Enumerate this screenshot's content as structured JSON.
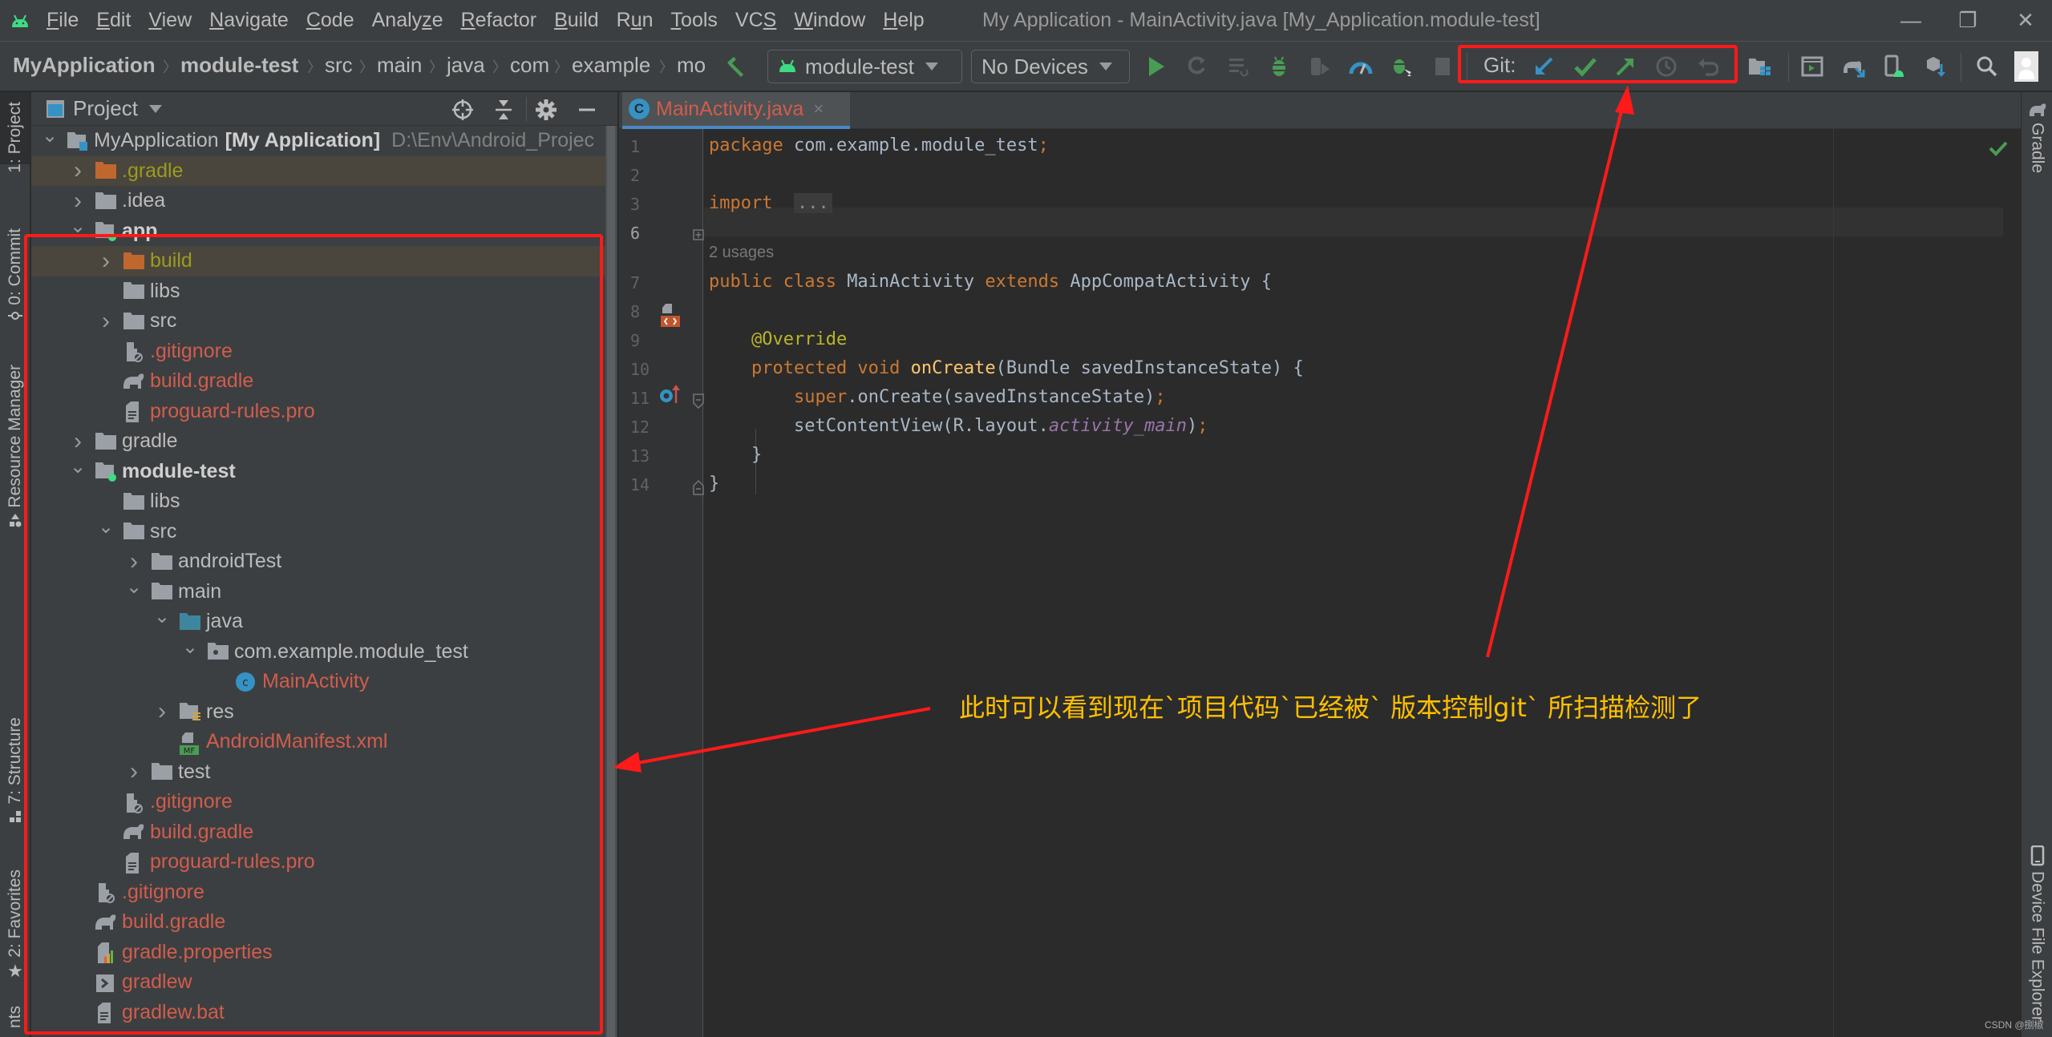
{
  "menubar": {
    "items": [
      "File",
      "Edit",
      "View",
      "Navigate",
      "Code",
      "Analyze",
      "Refactor",
      "Build",
      "Run",
      "Tools",
      "VCS",
      "Window",
      "Help"
    ],
    "mnemonics": [
      "F",
      "E",
      "V",
      "N",
      "C",
      "z",
      "R",
      "B",
      "u",
      "T",
      "S",
      "W",
      "H"
    ],
    "window_title": "My Application - MainActivity.java [My_Application.module-test]",
    "controls": {
      "minimize": "—",
      "restore": "❐",
      "close": "✕"
    }
  },
  "toolbar": {
    "breadcrumbs": [
      "MyApplication",
      "module-test",
      "src",
      "main",
      "java",
      "com",
      "example",
      "mo"
    ],
    "run_config": "module-test",
    "device": "No Devices",
    "git_label": "Git:",
    "git_actions": [
      "update-project",
      "commit",
      "push",
      "show-history",
      "rollback"
    ],
    "icons": [
      "make-project",
      "run",
      "apply-changes",
      "apply-code-changes",
      "debug",
      "profile",
      "attach-debugger",
      "stop",
      "project-structure",
      "avd-manager",
      "sync-gradle",
      "sdk-manager",
      "device-manager",
      "search",
      "account"
    ]
  },
  "left_strip": {
    "tabs": [
      "1: Project",
      "0: Commit",
      "Resource Manager",
      "7: Structure",
      "2: Favorites",
      "nts"
    ]
  },
  "project_panel": {
    "title": "Project",
    "tree": [
      {
        "label": "MyApplication",
        "extra": "[My Application]",
        "path": "D:\\Env\\Android_Projec",
        "depth": 0,
        "expand": "open",
        "icon": "module",
        "style": "normal"
      },
      {
        "label": ".gradle",
        "depth": 1,
        "expand": "closed",
        "icon": "folder-orange",
        "style": "olive",
        "excluded": true
      },
      {
        "label": ".idea",
        "depth": 1,
        "expand": "closed",
        "icon": "folder",
        "style": "normal"
      },
      {
        "label": "app",
        "depth": 1,
        "expand": "open",
        "icon": "module-app",
        "style": "bold"
      },
      {
        "label": "build",
        "depth": 2,
        "expand": "closed",
        "icon": "folder-orange",
        "style": "olive",
        "excluded": true
      },
      {
        "label": "libs",
        "depth": 2,
        "expand": "none",
        "icon": "folder",
        "style": "normal"
      },
      {
        "label": "src",
        "depth": 2,
        "expand": "closed",
        "icon": "folder",
        "style": "normal"
      },
      {
        "label": ".gitignore",
        "depth": 2,
        "expand": "none",
        "icon": "file-ignore",
        "style": "red"
      },
      {
        "label": "build.gradle",
        "depth": 2,
        "expand": "none",
        "icon": "gradle",
        "style": "red"
      },
      {
        "label": "proguard-rules.pro",
        "depth": 2,
        "expand": "none",
        "icon": "file-text",
        "style": "red"
      },
      {
        "label": "gradle",
        "depth": 1,
        "expand": "closed",
        "icon": "folder",
        "style": "normal"
      },
      {
        "label": "module-test",
        "depth": 1,
        "expand": "open",
        "icon": "module-app",
        "style": "bold"
      },
      {
        "label": "libs",
        "depth": 2,
        "expand": "none",
        "icon": "folder",
        "style": "normal"
      },
      {
        "label": "src",
        "depth": 2,
        "expand": "open",
        "icon": "folder",
        "style": "normal"
      },
      {
        "label": "androidTest",
        "depth": 3,
        "expand": "closed",
        "icon": "folder",
        "style": "normal"
      },
      {
        "label": "main",
        "depth": 3,
        "expand": "open",
        "icon": "folder",
        "style": "normal"
      },
      {
        "label": "java",
        "depth": 4,
        "expand": "open",
        "icon": "folder-blue",
        "style": "normal"
      },
      {
        "label": "com.example.module_test",
        "depth": 5,
        "expand": "open",
        "icon": "package",
        "style": "normal"
      },
      {
        "label": "MainActivity",
        "depth": 6,
        "expand": "none",
        "icon": "class",
        "style": "red"
      },
      {
        "label": "res",
        "depth": 4,
        "expand": "closed",
        "icon": "folder-res",
        "style": "normal"
      },
      {
        "label": "AndroidManifest.xml",
        "depth": 4,
        "expand": "none",
        "icon": "manifest",
        "style": "red"
      },
      {
        "label": "test",
        "depth": 3,
        "expand": "closed",
        "icon": "folder",
        "style": "normal"
      },
      {
        "label": ".gitignore",
        "depth": 2,
        "expand": "none",
        "icon": "file-ignore",
        "style": "red"
      },
      {
        "label": "build.gradle",
        "depth": 2,
        "expand": "none",
        "icon": "gradle",
        "style": "red"
      },
      {
        "label": "proguard-rules.pro",
        "depth": 2,
        "expand": "none",
        "icon": "file-text",
        "style": "red"
      },
      {
        "label": ".gitignore",
        "depth": 1,
        "expand": "none",
        "icon": "file-ignore",
        "style": "red"
      },
      {
        "label": "build.gradle",
        "depth": 1,
        "expand": "none",
        "icon": "gradle",
        "style": "red"
      },
      {
        "label": "gradle.properties",
        "depth": 1,
        "expand": "none",
        "icon": "properties",
        "style": "red"
      },
      {
        "label": "gradlew",
        "depth": 1,
        "expand": "none",
        "icon": "shell",
        "style": "red"
      },
      {
        "label": "gradlew.bat",
        "depth": 1,
        "expand": "none",
        "icon": "file-text",
        "style": "red"
      }
    ]
  },
  "editor": {
    "tab": {
      "label": "MainActivity.java",
      "icon": "C",
      "close": "×"
    },
    "usages_hint": "2 usages",
    "lines": [
      {
        "num": "1",
        "tokens": [
          [
            "kw",
            "package"
          ],
          [
            "",
            "com.example.module_test"
          ],
          [
            "kw",
            ";"
          ]
        ]
      },
      {
        "num": "2",
        "tokens": []
      },
      {
        "num": "3",
        "tokens": [
          [
            "kw",
            "import"
          ],
          [
            "",
            "  "
          ],
          [
            "dots",
            "..."
          ]
        ]
      },
      {
        "num": "6",
        "tokens": []
      },
      {
        "num": "7",
        "tokens": [
          [
            "kw",
            "public class "
          ],
          [
            "",
            "MainActivity "
          ],
          [
            "kw",
            "extends "
          ],
          [
            "",
            "AppCompatActivity {"
          ]
        ]
      },
      {
        "num": "8",
        "tokens": []
      },
      {
        "num": "9",
        "tokens": [
          [
            "",
            "    "
          ],
          [
            "ann",
            "@Override"
          ]
        ]
      },
      {
        "num": "10",
        "tokens": [
          [
            "",
            "    "
          ],
          [
            "kw",
            "protected void "
          ],
          [
            "fn",
            "onCreate"
          ],
          [
            "",
            "(Bundle savedInstanceState) {"
          ]
        ]
      },
      {
        "num": "11",
        "tokens": [
          [
            "",
            "        "
          ],
          [
            "kw",
            "super"
          ],
          [
            "",
            ".onCreate(savedInstanceState)"
          ],
          [
            "kw",
            ";"
          ]
        ]
      },
      {
        "num": "12",
        "tokens": [
          [
            "",
            "        setContentView(R.layout."
          ],
          [
            "fld",
            "activity_main"
          ],
          [
            "",
            ")"
          ],
          [
            "kw",
            ";"
          ]
        ]
      },
      {
        "num": "13",
        "tokens": [
          [
            "",
            "    }"
          ]
        ]
      },
      {
        "num": "14",
        "tokens": [
          [
            "",
            "}"
          ]
        ]
      }
    ]
  },
  "right_strip": {
    "tabs": [
      "Gradle",
      "Device File Explorer"
    ]
  },
  "annotation": {
    "text": "此时可以看到现在`项目代码`已经被` 版本控制git` 所扫描检测了",
    "color": "#ffc000",
    "box_color": "#ff1a1a"
  },
  "watermark": "CSDN @捌椒"
}
